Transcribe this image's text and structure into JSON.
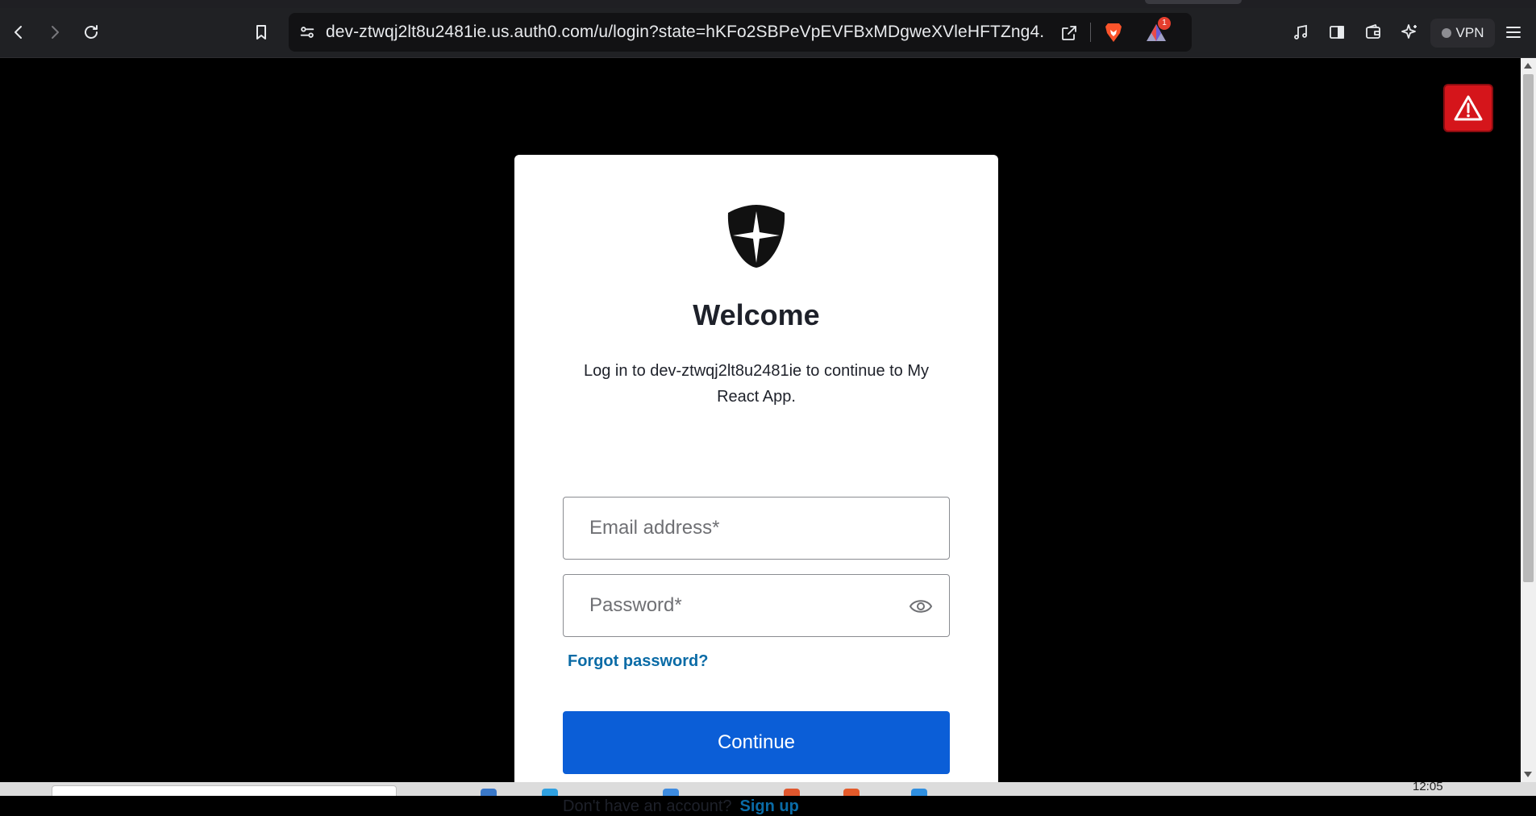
{
  "browser": {
    "url": "dev-ztwqj2lt8u2481ie.us.auth0.com/u/login?state=hKFo2SBPeVpEVFBxMDgweXVleHFTZng4...",
    "rewards_badge": "1",
    "vpn_label": "VPN",
    "icons": {
      "back": "back-arrow-icon",
      "forward": "forward-arrow-icon",
      "reload": "reload-icon",
      "bookmark": "bookmark-icon",
      "site_info": "site-settings-icon",
      "share": "share-icon",
      "shield": "brave-shield-icon",
      "rewards": "brave-rewards-icon",
      "media": "music-note-icon",
      "sidebar": "sidebar-icon",
      "wallet": "wallet-icon",
      "leo": "leo-ai-icon",
      "menu": "hamburger-menu-icon"
    }
  },
  "login": {
    "title": "Welcome",
    "subtitle": "Log in to dev-ztwqj2lt8u2481ie to continue to My React App.",
    "email_placeholder": "Email address*",
    "password_placeholder": "Password*",
    "forgot_password": "Forgot password?",
    "continue_label": "Continue",
    "no_account_text": "Don't have an account?",
    "signup_label": "Sign up"
  },
  "taskbar": {
    "clock": "12:05"
  },
  "colors": {
    "primary_button": "#0b5ed7",
    "link": "#0a6ba6",
    "warning": "#d5151b",
    "page_background": "#000000",
    "card_background": "#ffffff"
  }
}
